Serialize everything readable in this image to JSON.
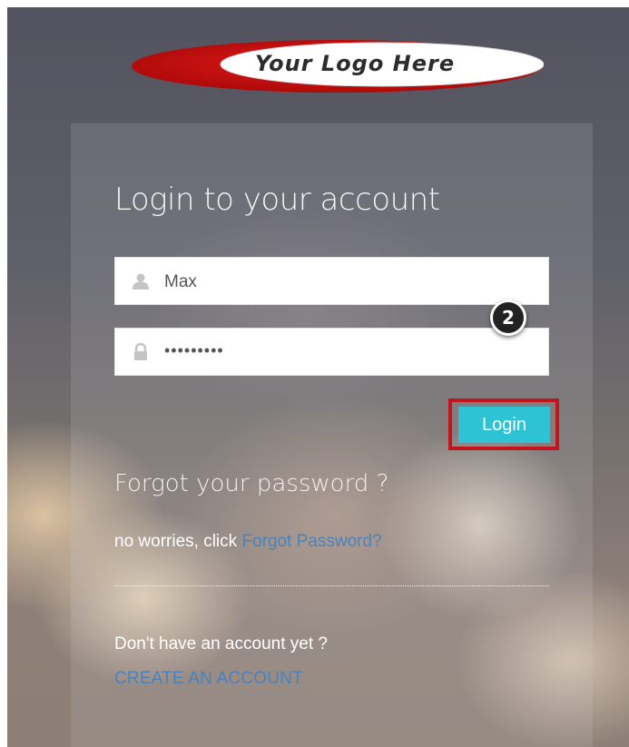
{
  "logo": {
    "text": "Your Logo Here"
  },
  "login_form": {
    "title": "Login to your account",
    "username": {
      "value": "Max",
      "icon": "user-icon"
    },
    "password": {
      "value": "•••••••••",
      "icon": "lock-icon"
    },
    "login_button_label": "Login",
    "step_badge": "2"
  },
  "forgot": {
    "heading": "Forgot your password ?",
    "text": "no worries, click",
    "link": "Forgot Password?"
  },
  "signup": {
    "question": "Don't have an account yet ?",
    "link": "CREATE AN ACCOUNT"
  },
  "colors": {
    "button": "#2dc3d4",
    "highlight": "#c3141e",
    "link": "#4b82bc",
    "logo_ring": "#cc1111"
  }
}
